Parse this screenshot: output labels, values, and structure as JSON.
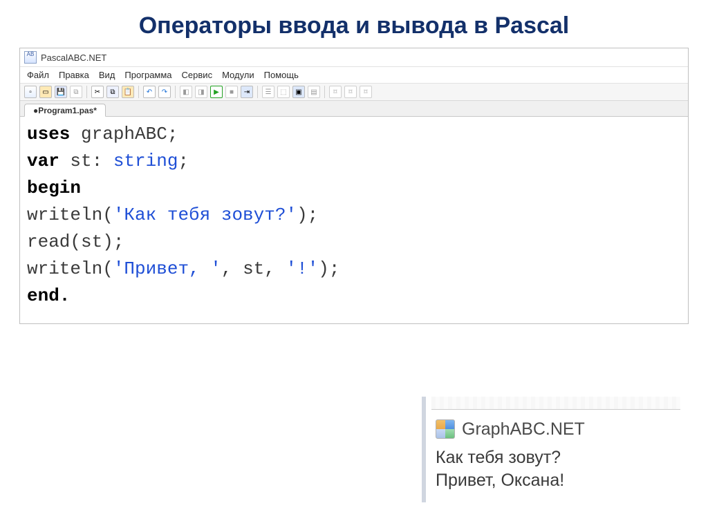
{
  "slide": {
    "title": "Операторы ввода и вывода в Pascal"
  },
  "app": {
    "title": "PascalABC.NET"
  },
  "menu": {
    "file": "Файл",
    "edit": "Правка",
    "view": "Вид",
    "program": "Программа",
    "service": "Сервис",
    "modules": "Модули",
    "help": "Помощь"
  },
  "tab": {
    "label": "●Program1.pas*"
  },
  "code": {
    "uses": "uses",
    "graphabc": " graphABC;",
    "var": "var",
    "st_decl": " st: ",
    "string_t": "string",
    "semicolon": ";",
    "begin": "begin",
    "writeln1a": "writeln(",
    "str1": "'Как тебя зовут?'",
    "writeln1b": ");",
    "read_line": "read(st);",
    "writeln2a": "writeln(",
    "str2a": "'Привет, '",
    "comma1": ", st, ",
    "str2b": "'!'",
    "writeln2b": ");",
    "end": "end."
  },
  "output": {
    "title": "GraphABC.NET",
    "line1": "Как тебя зовут?",
    "line2": "Привет, Оксана!"
  }
}
